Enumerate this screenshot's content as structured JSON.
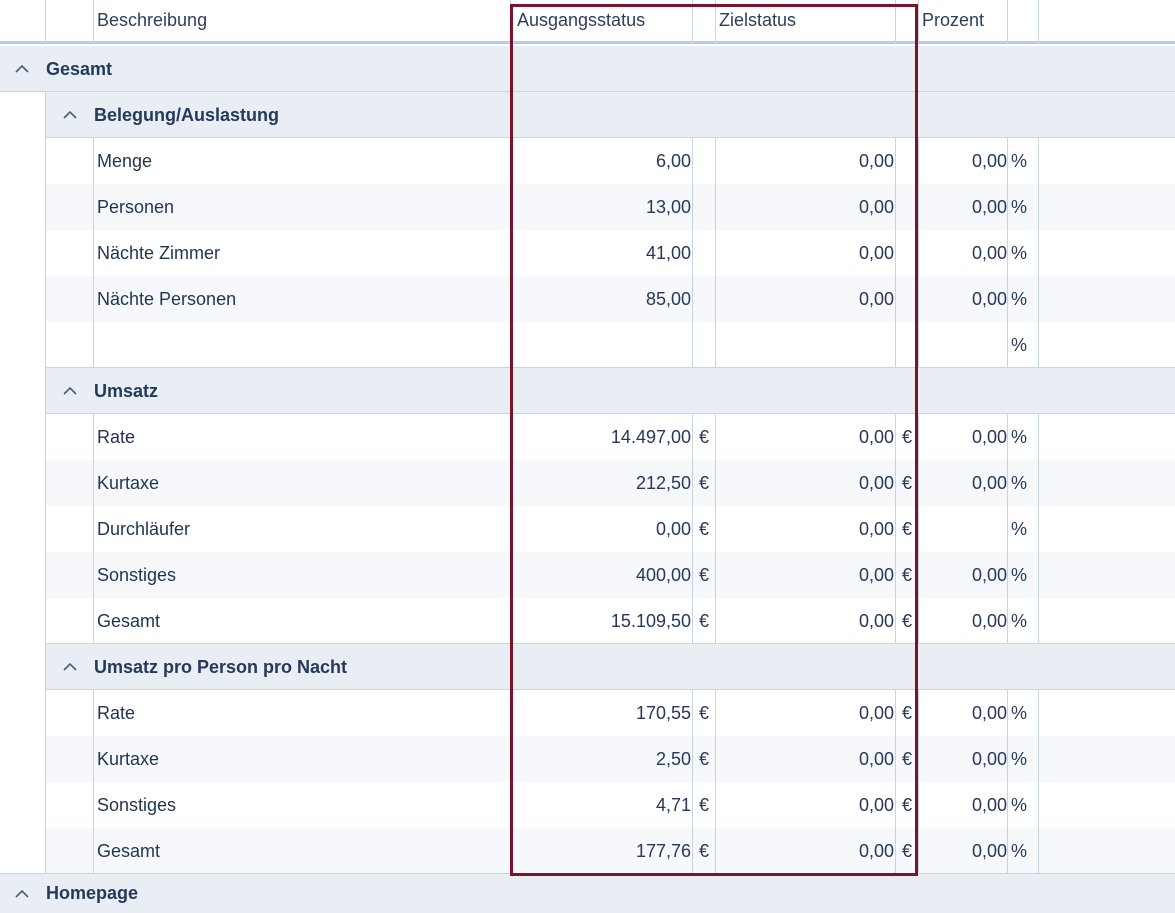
{
  "columns": {
    "beschreibung": "Beschreibung",
    "ausgangsstatus": "Ausgangsstatus",
    "zielstatus": "Zielstatus",
    "prozent": "Prozent"
  },
  "groups": {
    "gesamt": "Gesamt",
    "belegung": "Belegung/Auslastung",
    "umsatz": "Umsatz",
    "umsatz_pp": "Umsatz pro Person pro Nacht",
    "homepage": "Homepage"
  },
  "belegung_rows": [
    {
      "label": "Menge",
      "start": "6,00",
      "start_unit": "",
      "target": "0,00",
      "target_unit": "",
      "pct": "0,00",
      "pct_unit": "%"
    },
    {
      "label": "Personen",
      "start": "13,00",
      "start_unit": "",
      "target": "0,00",
      "target_unit": "",
      "pct": "0,00",
      "pct_unit": "%"
    },
    {
      "label": "Nächte Zimmer",
      "start": "41,00",
      "start_unit": "",
      "target": "0,00",
      "target_unit": "",
      "pct": "0,00",
      "pct_unit": "%"
    },
    {
      "label": "Nächte Personen",
      "start": "85,00",
      "start_unit": "",
      "target": "0,00",
      "target_unit": "",
      "pct": "0,00",
      "pct_unit": "%"
    },
    {
      "label": "",
      "start": "",
      "start_unit": "",
      "target": "",
      "target_unit": "",
      "pct": "",
      "pct_unit": "%"
    }
  ],
  "umsatz_rows": [
    {
      "label": "Rate",
      "start": "14.497,00",
      "start_unit": "€",
      "target": "0,00",
      "target_unit": "€",
      "pct": "0,00",
      "pct_unit": "%"
    },
    {
      "label": "Kurtaxe",
      "start": "212,50",
      "start_unit": "€",
      "target": "0,00",
      "target_unit": "€",
      "pct": "0,00",
      "pct_unit": "%"
    },
    {
      "label": "Durchläufer",
      "start": "0,00",
      "start_unit": "€",
      "target": "0,00",
      "target_unit": "€",
      "pct": "",
      "pct_unit": "%"
    },
    {
      "label": "Sonstiges",
      "start": "400,00",
      "start_unit": "€",
      "target": "0,00",
      "target_unit": "€",
      "pct": "0,00",
      "pct_unit": "%"
    },
    {
      "label": "Gesamt",
      "start": "15.109,50",
      "start_unit": "€",
      "target": "0,00",
      "target_unit": "€",
      "pct": "0,00",
      "pct_unit": "%"
    }
  ],
  "umsatz_pp_rows": [
    {
      "label": "Rate",
      "start": "170,55",
      "start_unit": "€",
      "target": "0,00",
      "target_unit": "€",
      "pct": "0,00",
      "pct_unit": "%"
    },
    {
      "label": "Kurtaxe",
      "start": "2,50",
      "start_unit": "€",
      "target": "0,00",
      "target_unit": "€",
      "pct": "0,00",
      "pct_unit": "%"
    },
    {
      "label": "Sonstiges",
      "start": "4,71",
      "start_unit": "€",
      "target": "0,00",
      "target_unit": "€",
      "pct": "0,00",
      "pct_unit": "%"
    },
    {
      "label": "Gesamt",
      "start": "177,76",
      "start_unit": "€",
      "target": "0,00",
      "target_unit": "€",
      "pct": "0,00",
      "pct_unit": "%"
    }
  ],
  "colors": {
    "highlight_border": "#7a1426",
    "group_bg": "#e9eef5",
    "alt_row_bg": "#f6f8fc",
    "text": "#25395a"
  }
}
